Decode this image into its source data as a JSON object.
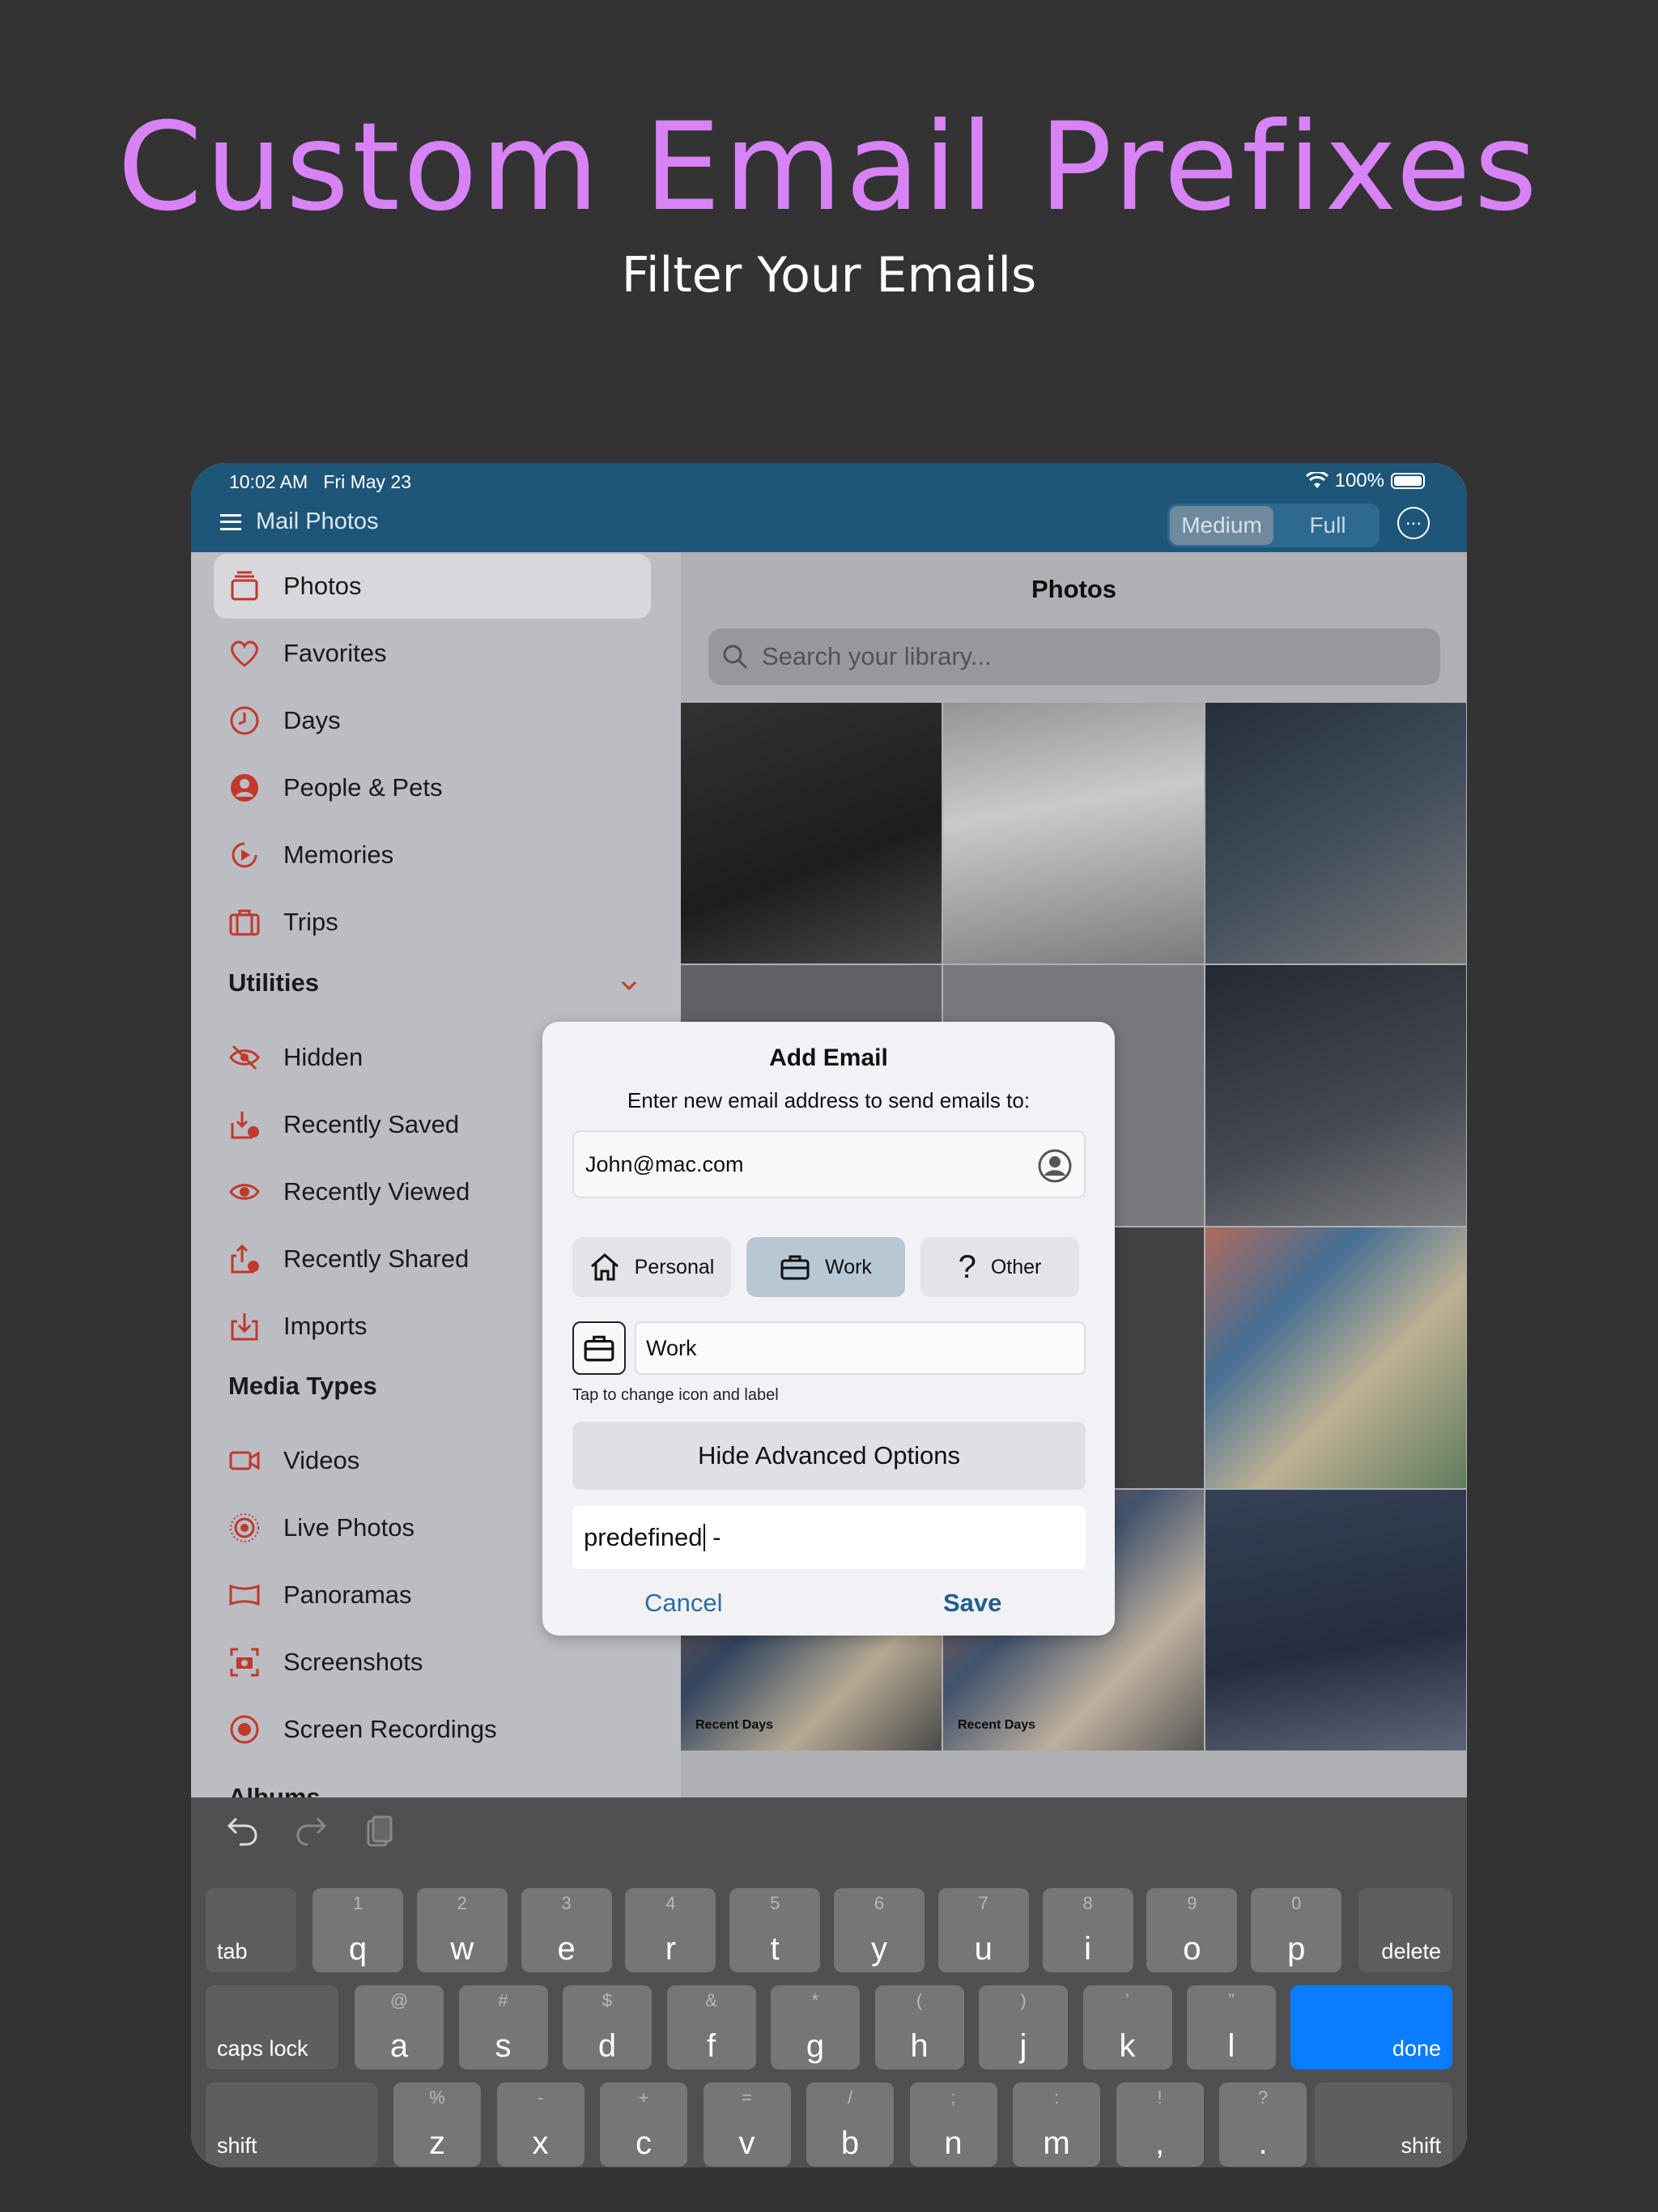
{
  "promo": {
    "title": "Custom Email Prefixes",
    "subtitle": "Filter Your Emails"
  },
  "status": {
    "time": "10:02 AM",
    "date": "Fri May 23",
    "battery": "100%"
  },
  "navbar": {
    "title": "Mail Photos",
    "segments": [
      "Medium",
      "Full"
    ],
    "selected_segment": "Medium"
  },
  "sidebar": {
    "items": [
      {
        "label": "Photos",
        "icon": "photos-stack-icon"
      },
      {
        "label": "Favorites",
        "icon": "heart-icon"
      },
      {
        "label": "Days",
        "icon": "clock-icon"
      },
      {
        "label": "People & Pets",
        "icon": "person-circle-icon"
      },
      {
        "label": "Memories",
        "icon": "memories-play-icon"
      },
      {
        "label": "Trips",
        "icon": "suitcase-icon"
      }
    ],
    "utilities_header": "Utilities",
    "utilities": [
      {
        "label": "Hidden",
        "icon": "eye-slash-icon"
      },
      {
        "label": "Recently Saved",
        "icon": "tray-download-icon"
      },
      {
        "label": "Recently Viewed",
        "icon": "eye-icon"
      },
      {
        "label": "Recently Shared",
        "icon": "share-icon"
      },
      {
        "label": "Imports",
        "icon": "import-icon"
      }
    ],
    "media_header": "Media Types",
    "media": [
      {
        "label": "Videos",
        "icon": "video-icon"
      },
      {
        "label": "Live Photos",
        "icon": "live-photo-icon"
      },
      {
        "label": "Panoramas",
        "icon": "panorama-icon"
      },
      {
        "label": "Screenshots",
        "icon": "screenshot-icon"
      },
      {
        "label": "Screen Recordings",
        "icon": "record-icon"
      }
    ],
    "albums_header": "Albums"
  },
  "content": {
    "title": "Photos",
    "search_placeholder": "Search your library...",
    "recent_days_label": "Recent Days"
  },
  "dialog": {
    "title": "Add Email",
    "subtitle": "Enter new email address to send emails to:",
    "email_value": "John@mac.com",
    "types": [
      {
        "label": "Personal",
        "icon": "house-icon"
      },
      {
        "label": "Work",
        "icon": "briefcase-icon"
      },
      {
        "label": "Other",
        "icon": "question-icon"
      }
    ],
    "selected_type": "Work",
    "label_value": "Work",
    "hint": "Tap to change icon and label",
    "advanced_button": "Hide Advanced Options",
    "prefix_before_caret": "predefined",
    "prefix_after_caret": " -",
    "cancel": "Cancel",
    "save": "Save"
  },
  "keyboard": {
    "row1": [
      [
        "1",
        "q"
      ],
      [
        "2",
        "w"
      ],
      [
        "3",
        "e"
      ],
      [
        "4",
        "r"
      ],
      [
        "5",
        "t"
      ],
      [
        "6",
        "y"
      ],
      [
        "7",
        "u"
      ],
      [
        "8",
        "i"
      ],
      [
        "9",
        "o"
      ],
      [
        "0",
        "p"
      ]
    ],
    "row2": [
      [
        "@",
        "a"
      ],
      [
        "#",
        "s"
      ],
      [
        "$",
        "d"
      ],
      [
        "&",
        "f"
      ],
      [
        "*",
        "g"
      ],
      [
        "(",
        "h"
      ],
      [
        ")",
        "j"
      ],
      [
        "’",
        "k"
      ],
      [
        "”",
        "l"
      ]
    ],
    "row3": [
      [
        "%",
        "z"
      ],
      [
        "-",
        "x"
      ],
      [
        "+",
        "c"
      ],
      [
        "=",
        "v"
      ],
      [
        "/",
        "b"
      ],
      [
        ";",
        "n"
      ],
      [
        ":",
        "m"
      ],
      [
        "!",
        ","
      ],
      [
        "?",
        "."
      ]
    ],
    "tab": "tab",
    "delete": "delete",
    "caps_lock": "caps lock",
    "done": "done",
    "shift": "shift",
    "accent_color": "#0a7cff"
  },
  "colors": {
    "promo_title": "#d783f5",
    "nav_bar": "#1e5679",
    "icon_red": "#c0392b"
  }
}
